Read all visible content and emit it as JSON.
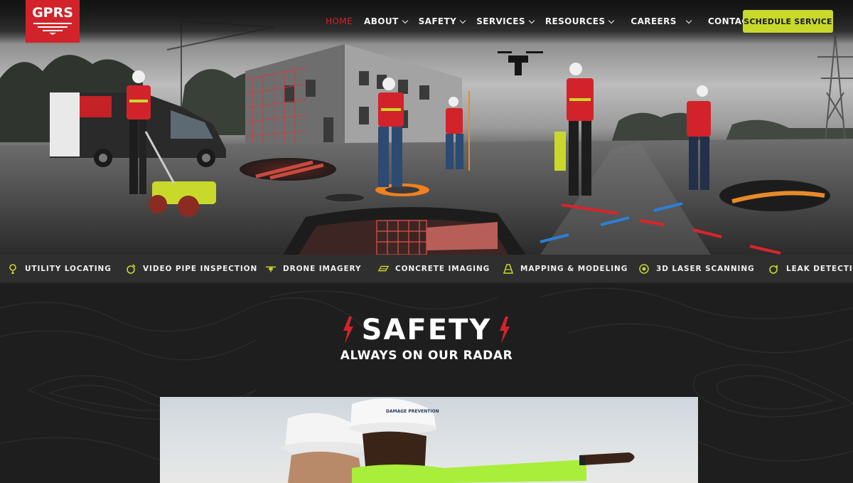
{
  "brand": {
    "logo_text": "GPRS",
    "accent": "#d2232a",
    "cta_color": "#c8d92b"
  },
  "nav": {
    "items": [
      {
        "label": "HOME",
        "active": true,
        "dropdown": false
      },
      {
        "label": "ABOUT",
        "active": false,
        "dropdown": true
      },
      {
        "label": "SAFETY",
        "active": false,
        "dropdown": true
      },
      {
        "label": "SERVICES",
        "active": false,
        "dropdown": true
      },
      {
        "label": "RESOURCES",
        "active": false,
        "dropdown": true
      },
      {
        "label": "CAREERS",
        "active": false,
        "dropdown": true
      },
      {
        "label": "CONTACT",
        "active": false,
        "dropdown": true
      }
    ],
    "cta_label": "SCHEDULE SERVICE"
  },
  "services": [
    {
      "label": "UTILITY LOCATING",
      "icon": "utility-locating-icon"
    },
    {
      "label": "VIDEO PIPE INSPECTION",
      "icon": "video-pipe-inspection-icon"
    },
    {
      "label": "DRONE IMAGERY",
      "icon": "drone-icon"
    },
    {
      "label": "CONCRETE IMAGING",
      "icon": "concrete-imaging-icon"
    },
    {
      "label": "MAPPING & MODELING",
      "icon": "mapping-icon"
    },
    {
      "label": "3D LASER SCANNING",
      "icon": "laser-scan-icon"
    },
    {
      "label": "LEAK DETECTION",
      "icon": "leak-detection-icon"
    }
  ],
  "safety": {
    "heading": "SAFETY",
    "subheading": "ALWAYS ON OUR RADAR",
    "helmet_text": "DAMAGE PREVENTION"
  }
}
